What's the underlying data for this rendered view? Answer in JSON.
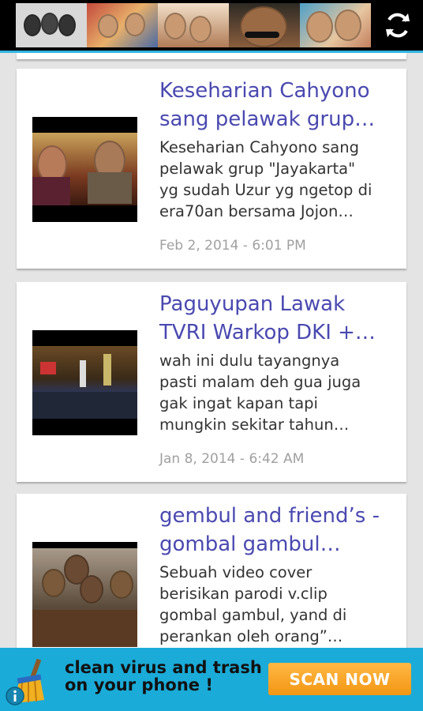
{
  "feed": {
    "posts": [
      {
        "title": "Keseharian Cahyono\nsang pelawak grup…",
        "snippet": "Keseharian Cahyono sang\npelawak grup \"Jayakarta\"\nyg sudah Uzur yg ngetop di\nera70an bersama Jojon…",
        "date": "Feb 2, 2014 - 6:01 PM"
      },
      {
        "title": "Paguyupan Lawak\nTVRI Warkop DKI +…",
        "snippet": "wah ini dulu tayangnya\npasti malam deh gua juga\ngak ingat kapan tapi\nmungkin sekitar tahun…",
        "date": "Jan 8, 2014 - 6:42 AM"
      },
      {
        "title": "gembul and friend’s -\ngombal gambul…",
        "snippet": "Sebuah video cover\nberisikan parodi v.clip\ngombal gambul, yand di\nperankan oleh orang”…",
        "date": ""
      }
    ]
  },
  "ad": {
    "text": "clean virus and trash\non your phone !",
    "button": "SCAN  NOW"
  },
  "colors": {
    "title": "#4a49b0",
    "accent_line": "#33b5e5",
    "ad_background": "#1aabd8",
    "ad_button": "#f39614"
  },
  "icons": {
    "refresh": "refresh-icon",
    "broom": "broom-icon",
    "info": "info-icon"
  }
}
